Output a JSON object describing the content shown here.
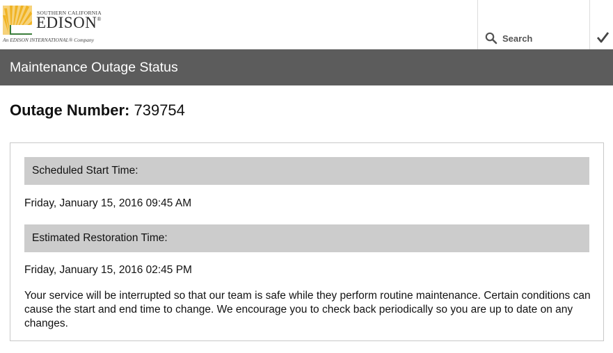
{
  "header": {
    "logo": {
      "small_text": "SOUTHERN CALIFORNIA",
      "big_text": "EDISON",
      "registered": "®",
      "tagline": "An EDISON INTERNATIONAL® Company"
    },
    "search_label": "Search",
    "icons": {
      "search": "search-icon",
      "submit": "checkmark-icon"
    }
  },
  "titlebar": {
    "title": "Maintenance Outage Status"
  },
  "outage": {
    "label": "Outage Number:",
    "number": "739754"
  },
  "details": {
    "start_label": "Scheduled Start Time:",
    "start_value": "Friday, January 15, 2016 09:45 AM",
    "restore_label": "Estimated Restoration Time:",
    "restore_value": "Friday, January 15, 2016 02:45 PM",
    "message": "Your service will be interrupted so that our team is safe while they perform routine maintenance. Certain conditions can cause the start and end time to change. We encourage you to check back periodically so you are up to date on any changes."
  },
  "colors": {
    "titlebar": "#5c5c5c",
    "section_head": "#cccccc",
    "logo_sun": "#f0b323"
  }
}
